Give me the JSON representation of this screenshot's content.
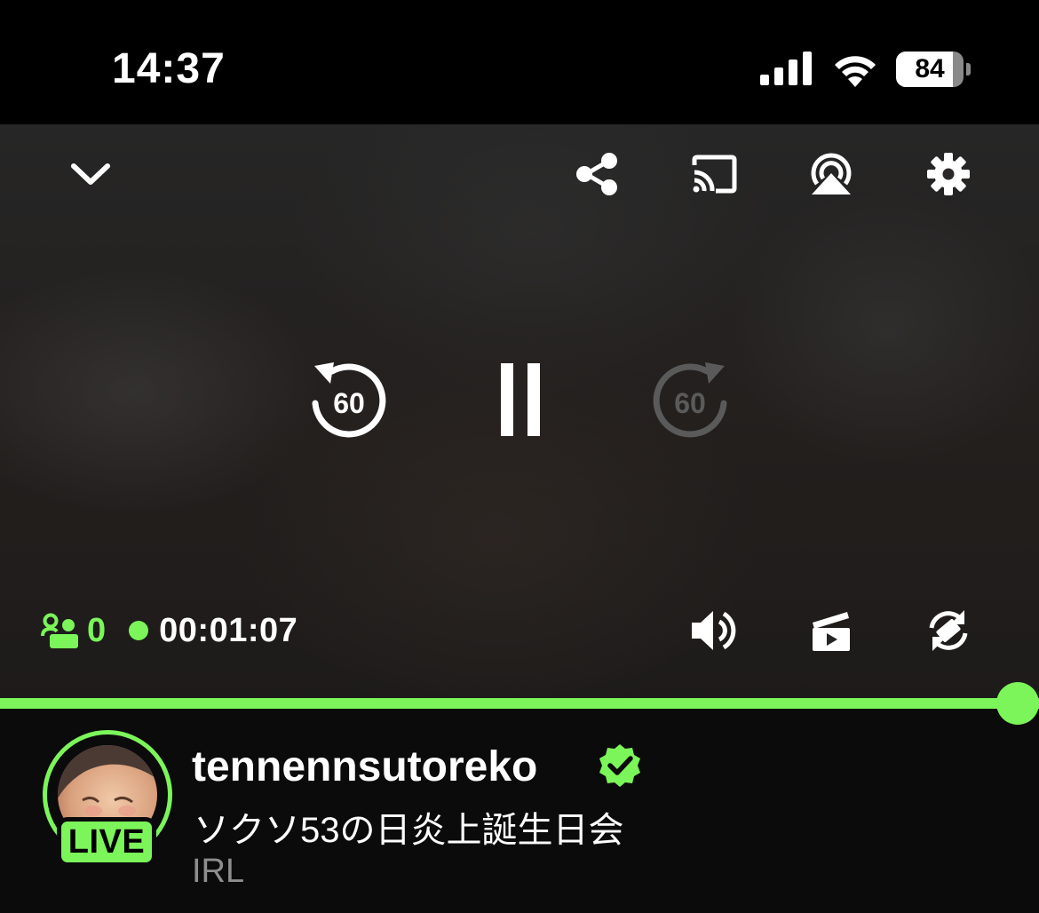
{
  "status_bar": {
    "time": "14:37",
    "battery_level": "84",
    "battery_fraction": 0.84,
    "icons": [
      "cellular-signal-icon",
      "wifi-icon",
      "battery-icon"
    ]
  },
  "player": {
    "top_controls": [
      "collapse-chevron-icon",
      "share-icon",
      "cast-icon",
      "airplay-icon",
      "settings-gear-icon"
    ],
    "rewind_label": "60",
    "forward_label": "60",
    "center_controls": [
      "rewind-60-icon",
      "pause-icon",
      "forward-60-icon"
    ],
    "viewer_count": "0",
    "elapsed_time": "00:01:07",
    "bottom_controls": [
      "volume-icon",
      "clip-icon",
      "rotate-icon"
    ],
    "progress": 1.0
  },
  "channel": {
    "name": "tennennsutoreko",
    "verified": true,
    "live_badge": "LIVE",
    "stream_title": "ソクソ53の日炎上誕生日会",
    "category": "IRL"
  },
  "colors": {
    "accent": "#7bf55a",
    "background": "#0b0b0c",
    "status_bar": "#000000",
    "muted_text": "#8e8e8e",
    "disabled_icon": "#5a5a5a"
  }
}
